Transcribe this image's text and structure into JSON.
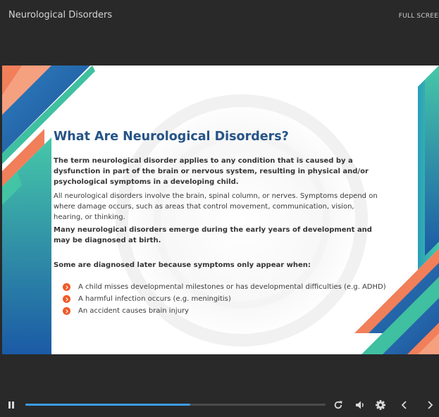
{
  "header": {
    "course_title": "Neurological Disorders",
    "fullscreen_label": "FULL SCREEN"
  },
  "slide": {
    "heading": "What Are Neurological Disorders?",
    "paragraph_1": "The term neurological disorder applies to any condition that is caused by a dysfunction in part of the brain or nervous system, resulting in physical and/or psychological symptoms in a developing child.",
    "paragraph_2": "All neurological disorders involve the brain, spinal column, or nerves. Symptoms depend on where damage occurs, such as areas that control movement, communication, vision, hearing, or thinking.",
    "paragraph_3": "Many neurological disorders emerge during the early years of development and may be diagnosed at birth.",
    "paragraph_4": "Some are diagnosed later because symptoms only appear when:",
    "bullets": [
      "A child misses developmental milestones or has developmental difficulties (e.g. ADHD)",
      "A harmful infection occurs (e.g. meningitis)",
      "An accident causes brain injury"
    ],
    "colors": {
      "heading": "#265487",
      "bullet_icon": "#f05a28",
      "accent_teal": "#3fbf9a",
      "accent_blue": "#1f5ea8",
      "accent_orange": "#f07f5a"
    }
  },
  "controls": {
    "progress": 0.55,
    "icons": [
      "pause-icon",
      "replay-icon",
      "volume-icon",
      "settings-icon",
      "prev-slide-icon",
      "next-slide-icon"
    ],
    "colors": {
      "progress_fill": "#3d9be3",
      "progress_track": "#4b4b4b"
    }
  }
}
